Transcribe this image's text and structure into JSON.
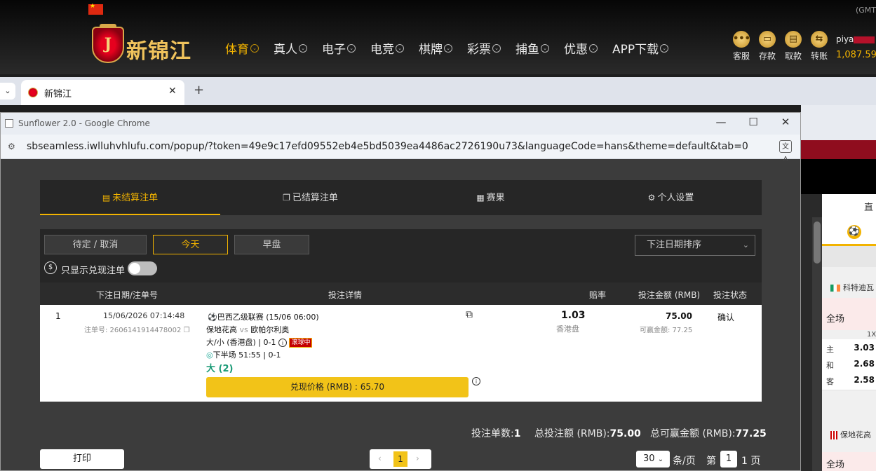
{
  "site": {
    "gmt": "(GMT",
    "logo_letter": "J",
    "logo_text": "新锦江",
    "nav": [
      "体育",
      "真人",
      "电子",
      "电竞",
      "棋牌",
      "彩票",
      "捕鱼",
      "优惠",
      "APP下载"
    ],
    "tools": [
      "客服",
      "存款",
      "取款",
      "转账"
    ],
    "username": "piya",
    "balance": "1,087.59"
  },
  "browser": {
    "tab_title": "新锦江"
  },
  "popup": {
    "window_title": "Sunflower 2.0 - Google Chrome",
    "url": "sbseamless.iwlluhvhlufu.com/popup/?token=49e9c17efd09552eb4e5bd5039ea4486ac2726190u73&languageCode=hans&theme=default&tab=0",
    "tabs": [
      "未结算注单",
      "已结算注单",
      "赛果",
      "个人设置"
    ],
    "filters": [
      "待定 / 取消",
      "今天",
      "早盘"
    ],
    "sort_label": "下注日期排序",
    "cashout_only_label": "只显示兑现注单",
    "table_headers": [
      "下注日期/注单号",
      "投注详情",
      "赔率",
      "投注金额 (RMB)",
      "投注状态"
    ],
    "bet": {
      "index": "1",
      "datetime": "15/06/2026 07:14:48",
      "bet_no_label": "注单号: 2606141914478002",
      "league": "巴西乙级联赛 (15/06 06:00)",
      "home": "保地花高",
      "vs": "vs",
      "away": "欧帕尔利奥",
      "market": "大/小 (香港盘)",
      "score": "0-1",
      "live": "滚球中",
      "period": "下半场 51:55",
      "period_score": "0-1",
      "selection": "大 (2)",
      "odds": "1.03",
      "odds_type": "香港盘",
      "stake": "75.00",
      "win_label": "可赢金额: 77.25",
      "status": "确认",
      "cashout_label": "兑现价格 (RMB) : 65.70"
    },
    "summary": {
      "count_label": "投注单数:",
      "count": "1",
      "total_label": "总投注额 (RMB):",
      "total": "75.00",
      "win_label": "总可赢金额 (RMB):",
      "win": "77.25"
    },
    "footer": {
      "print": "打印",
      "page": "1",
      "per_page": "30",
      "per_page_label": "条/页",
      "page_prefix": "第",
      "page_box": "1",
      "page_suffix": "1 页"
    }
  },
  "side": {
    "head": "直",
    "team1": "科特迪瓦",
    "section": "全场",
    "col": "1X",
    "rows": [
      {
        "k": "主",
        "v": "3.03"
      },
      {
        "k": "和",
        "v": "2.68"
      },
      {
        "k": "客",
        "v": "2.58"
      }
    ],
    "team2": "保地花高",
    "section2": "全场"
  },
  "colors": {
    "accent": "#f2b300",
    "cashout_button": "#f2c318",
    "live_badge": "#c40000"
  }
}
